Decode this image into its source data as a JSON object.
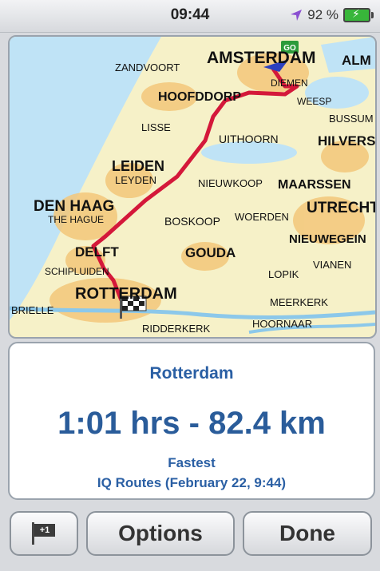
{
  "status_bar": {
    "time": "09:44",
    "battery_percent": "92 %",
    "location_icon": "location-arrow-icon",
    "battery_icon": "battery-charging-icon"
  },
  "map": {
    "labels": {
      "amsterdam": "AMSTERDAM",
      "alm": "ALM",
      "zandvoort": "ZANDVOORT",
      "hoofddorp": "HOOFDDORP",
      "diemen": "DIEMEN",
      "weesp": "WEESP",
      "bussum": "BUSSUM",
      "lisse": "LISSE",
      "uithoorn": "UITHOORN",
      "hilversum": "HILVERS",
      "leiden": "LEIDEN",
      "leyden": "LEYDEN",
      "nieuwkoop": "NIEUWKOOP",
      "maarssen": "MAARSSEN",
      "den_haag": "DEN HAAG",
      "the_hague": "THE HAGUE",
      "utrecht": "UTRECHT",
      "boskoop": "BOSKOOP",
      "woerden": "WOERDEN",
      "delft": "DELFT",
      "gouda": "GOUDA",
      "nieuwegein": "NIEUWEGEIN",
      "schipluiden": "SCHIPLUIDEN",
      "vianen": "VIANEN",
      "lopik": "LOPIK",
      "rotterdam": "ROTTERDAM",
      "brielle": "BRIELLE",
      "meerkerk": "MEERKERK",
      "ridderkerk": "RIDDERKERK",
      "hoornaar": "HOORNAAR",
      "go_badge": "GO"
    },
    "route_color": "#d4183a"
  },
  "route_info": {
    "destination": "Rotterdam",
    "summary": "1:01 hrs - 82.4 km",
    "route_type": "Fastest",
    "source": "IQ Routes (February 22,  9:44)"
  },
  "buttons": {
    "flag_badge": "+1",
    "options": "Options",
    "done": "Done"
  }
}
